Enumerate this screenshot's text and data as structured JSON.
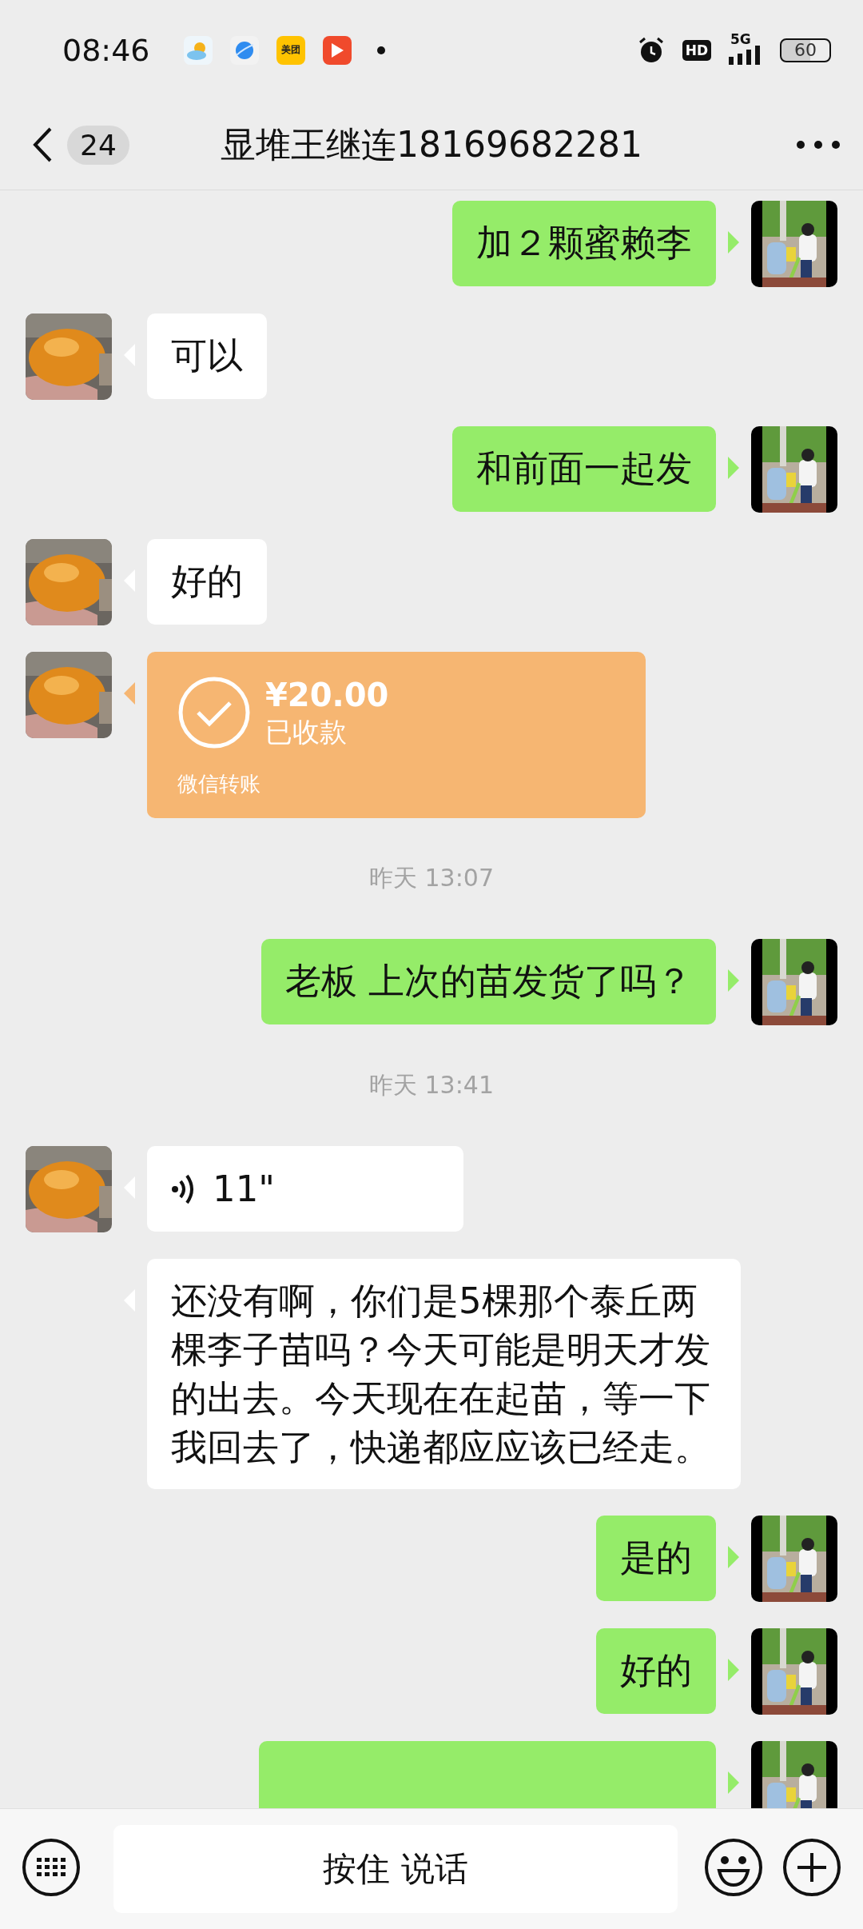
{
  "status_bar": {
    "time": "08:46",
    "app_icons": [
      {
        "kind": "weather"
      },
      {
        "kind": "browser"
      },
      {
        "kind": "meituan",
        "label": "美团"
      },
      {
        "kind": "video"
      }
    ],
    "hd": "HD",
    "network": "5G",
    "battery": "60"
  },
  "header": {
    "unread": "24",
    "title": "显堆王继连18169682281"
  },
  "messages": [
    {
      "kind": "text",
      "outgoing": true,
      "avatar": true,
      "text": "加２颗蜜赖李"
    },
    {
      "kind": "text",
      "outgoing": false,
      "avatar": true,
      "text": "可以"
    },
    {
      "kind": "text",
      "outgoing": true,
      "avatar": true,
      "text": "和前面一起发"
    },
    {
      "kind": "text",
      "outgoing": false,
      "avatar": true,
      "text": "好的"
    },
    {
      "kind": "transfer",
      "outgoing": false,
      "avatar": true,
      "amount": "¥20.00",
      "status": "已收款",
      "footer": "微信转账"
    },
    {
      "kind": "time",
      "text": "昨天 13:07"
    },
    {
      "kind": "text",
      "outgoing": true,
      "avatar": true,
      "text": "老板  上次的苗发货了吗？"
    },
    {
      "kind": "time",
      "text": "昨天 13:41"
    },
    {
      "kind": "voice",
      "outgoing": false,
      "avatar": true,
      "duration": "11\""
    },
    {
      "kind": "text",
      "outgoing": false,
      "avatar": false,
      "text": "还没有啊，你们是5棵那个泰丘两棵李子苗吗？今天可能是明天才发的出去。今天现在在起苗，等一下我回去了，快递都应应该已经走。"
    },
    {
      "kind": "text",
      "outgoing": true,
      "avatar": true,
      "text": "是的"
    },
    {
      "kind": "text",
      "outgoing": true,
      "avatar": true,
      "text": "好的"
    },
    {
      "kind": "partial",
      "outgoing": true,
      "avatar": true
    }
  ],
  "input_bar": {
    "hold_to_talk": "按住 说话"
  }
}
